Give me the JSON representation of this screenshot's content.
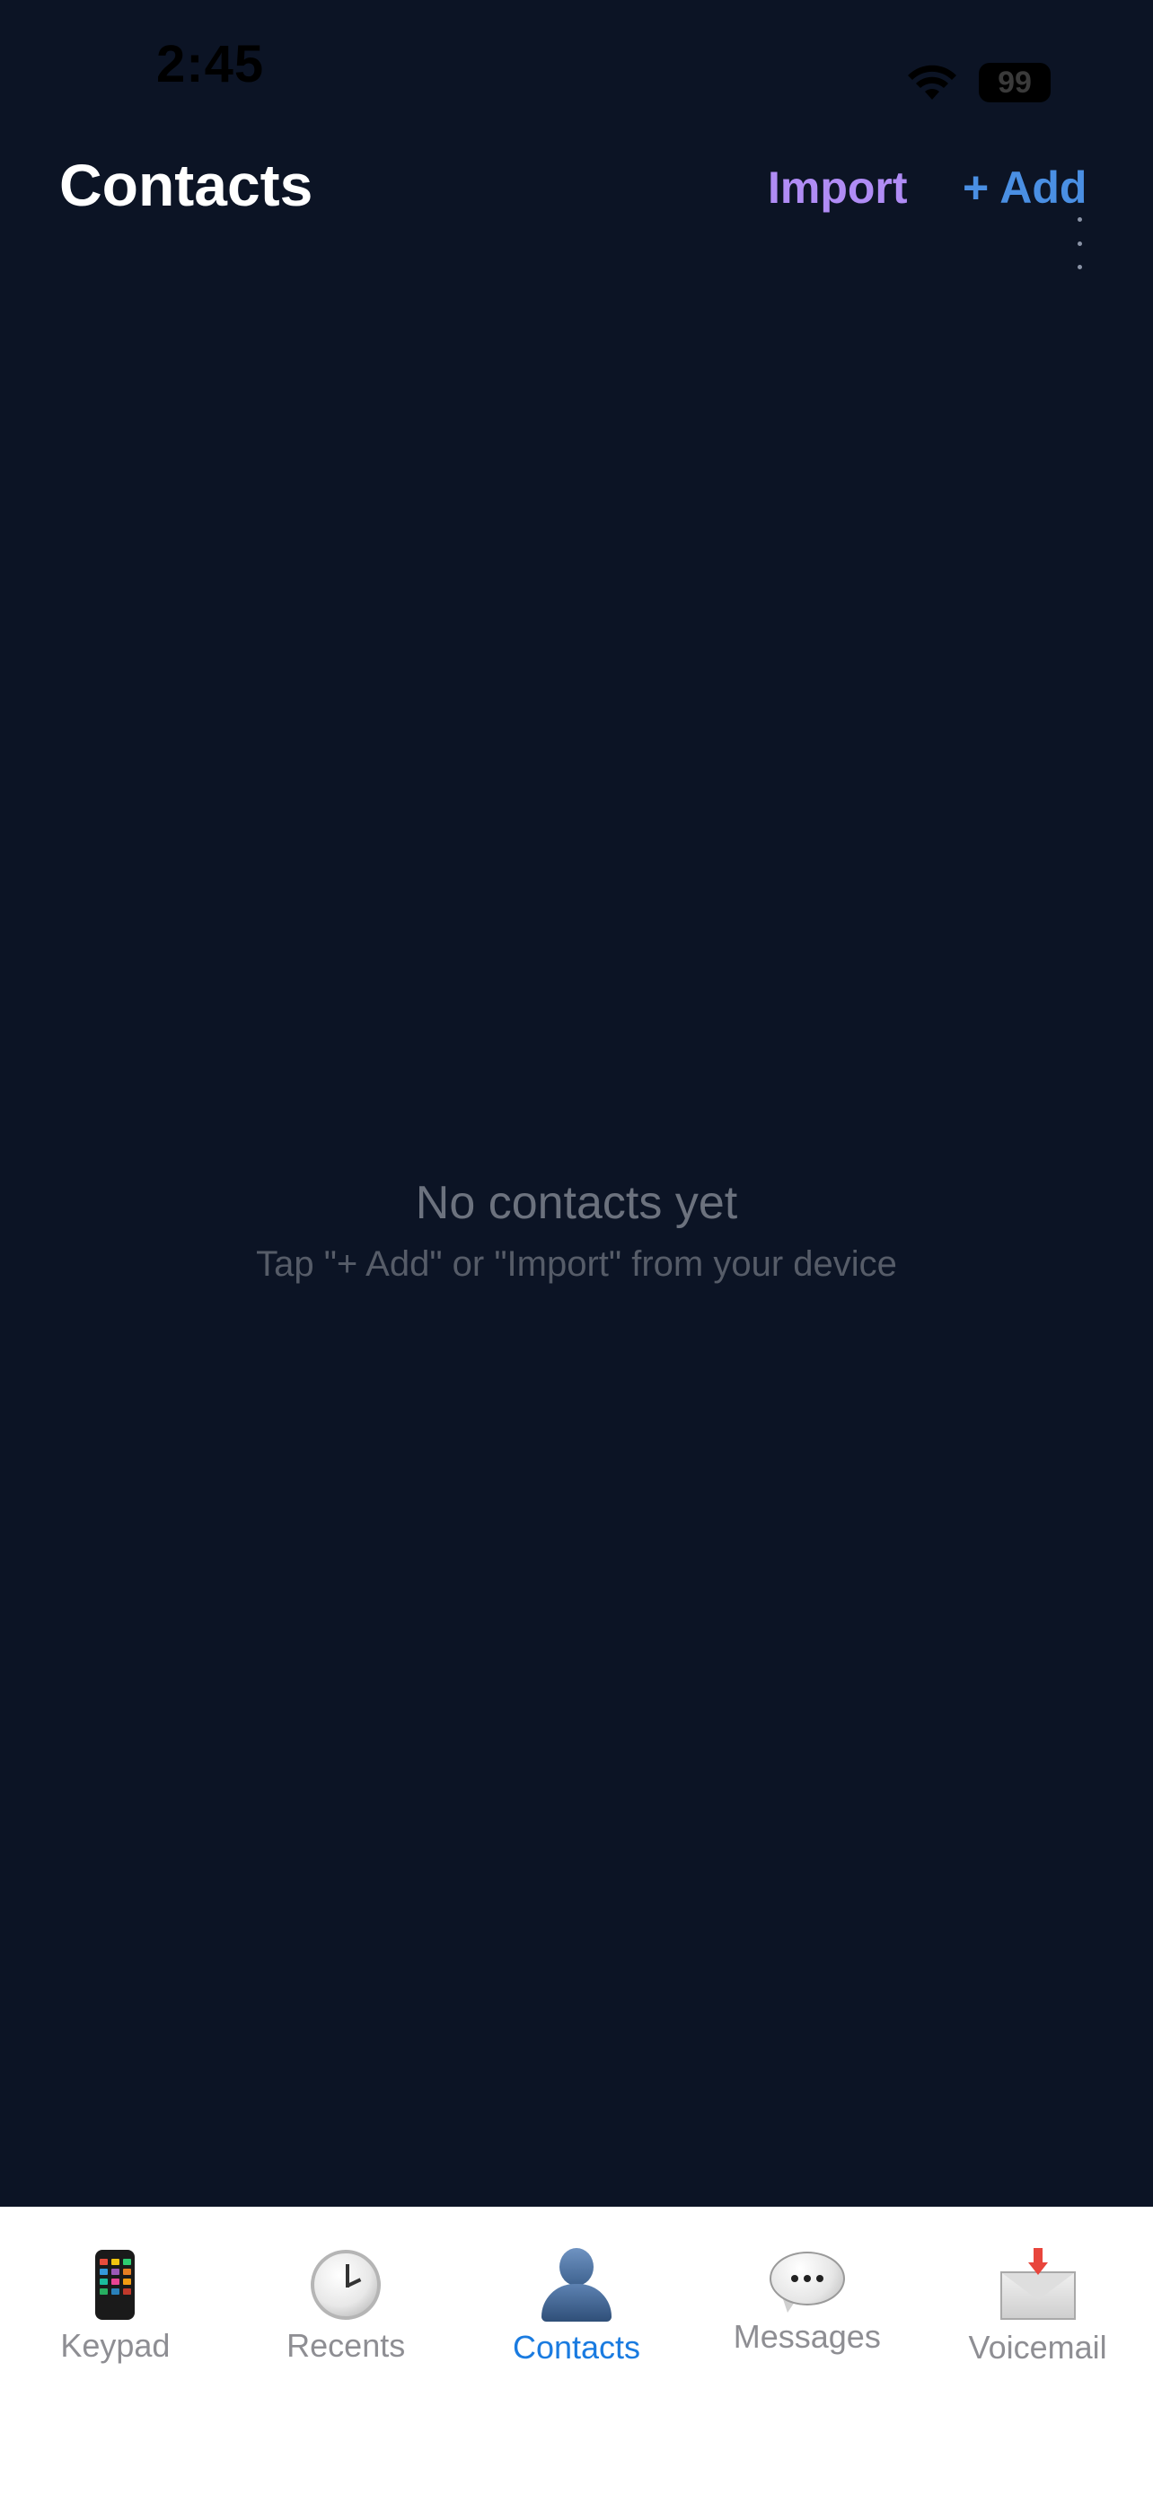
{
  "status_bar": {
    "time": "2:45",
    "battery": "99",
    "wifi_icon": "wifi-icon"
  },
  "header": {
    "title": "Contacts",
    "import_label": "Import",
    "add_label": "+ Add",
    "more_icon": "vertical-ellipsis-icon"
  },
  "empty_state": {
    "title": "No contacts yet",
    "subtitle": "Tap \"+ Add\" or \"Import\" from your device"
  },
  "tab_bar": {
    "tabs": [
      {
        "label": "Keypad",
        "icon": "keypad-phone-icon",
        "active": false
      },
      {
        "label": "Recents",
        "icon": "clock-icon",
        "active": false
      },
      {
        "label": "Contacts",
        "icon": "person-icon",
        "active": true
      },
      {
        "label": "Messages",
        "icon": "speech-bubble-icon",
        "active": false
      },
      {
        "label": "Voicemail",
        "icon": "envelope-icon",
        "active": false
      }
    ]
  },
  "colors": {
    "background": "#0c1425",
    "import_accent": "#b08cf5",
    "add_accent": "#4a8fe3",
    "active_tab": "#1a7be0",
    "inactive_tab": "#8e8e93"
  }
}
